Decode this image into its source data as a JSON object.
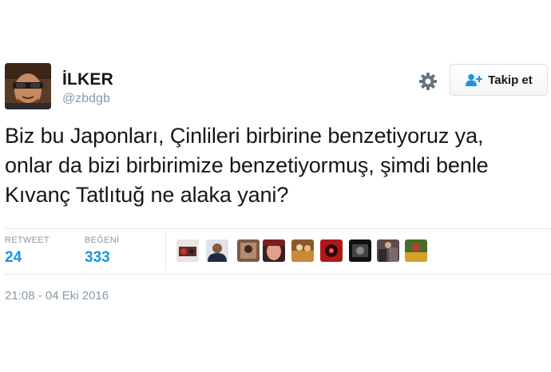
{
  "user": {
    "display_name": "İLKER",
    "handle": "@zbdgb"
  },
  "actions": {
    "settings_icon": "gear-icon",
    "follow_label": "Takip et",
    "follow_icon": "add-user-icon"
  },
  "tweet": {
    "lines": [
      "Biz bu Japonları, Çinlileri birbirine benzetiyoruz ya,",
      "onlar da bizi birbirimize benzetiyormuş, şimdi benle",
      "Kıvanç Tatlıtuğ ne alaka yani?"
    ],
    "timestamp": "21:08 - 04 Eki 2016"
  },
  "stats": {
    "retweet_label": "RETWEET",
    "retweet_count": "24",
    "like_label": "BEĞENİ",
    "like_count": "333"
  },
  "colors": {
    "accent": "#1b95e0",
    "muted": "#8899a6",
    "text": "#14171a",
    "border": "#e1e8ed"
  }
}
